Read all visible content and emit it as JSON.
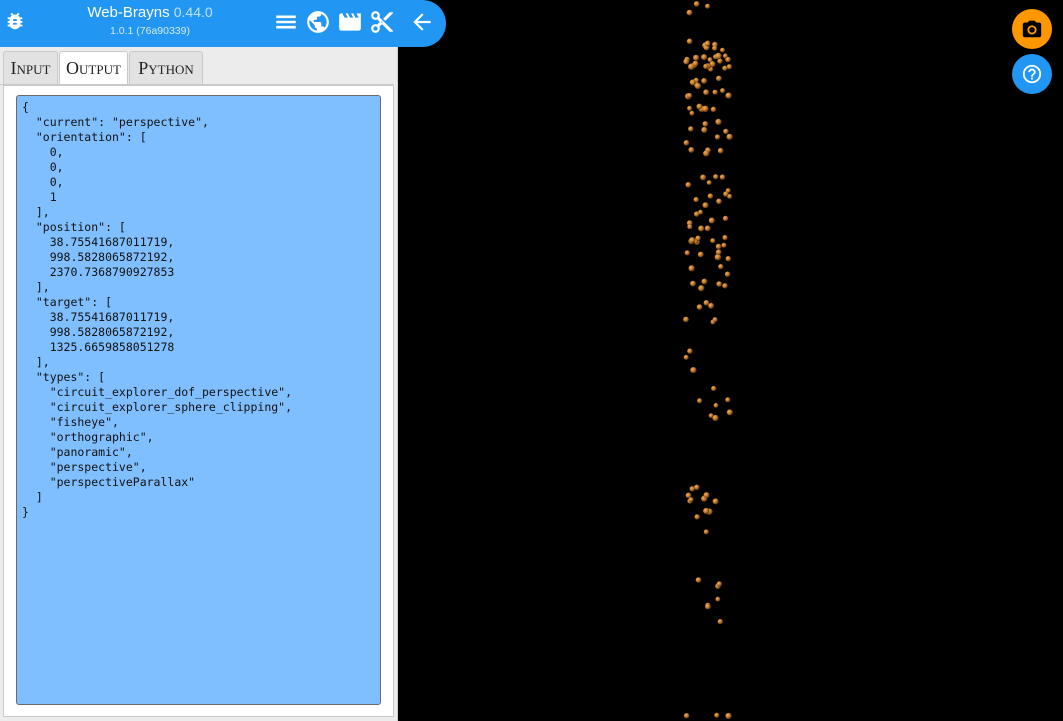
{
  "header": {
    "app_title": "Web-Brayns",
    "app_version": "0.44.0",
    "build": "1.0.1 (76a90339)",
    "icons": [
      "bug-icon",
      "menu-icon",
      "globe-icon",
      "movie-clapper-icon",
      "scissors-icon",
      "arrow-left-icon"
    ],
    "color": "#2196f3"
  },
  "tabs": [
    {
      "label": "Input",
      "active": false
    },
    {
      "label": "Output",
      "active": true
    },
    {
      "label": "Python",
      "active": false
    }
  ],
  "output": {
    "json_text": "{\n  \"current\": \"perspective\",\n  \"orientation\": [\n    0,\n    0,\n    0,\n    1\n  ],\n  \"position\": [\n    38.75541687011719,\n    998.5828065872192,\n    2370.7368790927853\n  ],\n  \"target\": [\n    38.75541687011719,\n    998.5828065872192,\n    1325.6659858051278\n  ],\n  \"types\": [\n    \"circuit_explorer_dof_perspective\",\n    \"circuit_explorer_sphere_clipping\",\n    \"fisheye\",\n    \"orthographic\",\n    \"panoramic\",\n    \"perspective\",\n    \"perspectiveParallax\"\n  ]\n}",
    "background_color": "#80bfff"
  },
  "fabs": {
    "snapshot": {
      "icon": "camera-icon",
      "color": "#ff9800"
    },
    "help": {
      "icon": "help-icon",
      "color": "#2196f3"
    }
  },
  "viewport": {
    "background": "#000000",
    "sphere_color": "#c07a2a"
  }
}
